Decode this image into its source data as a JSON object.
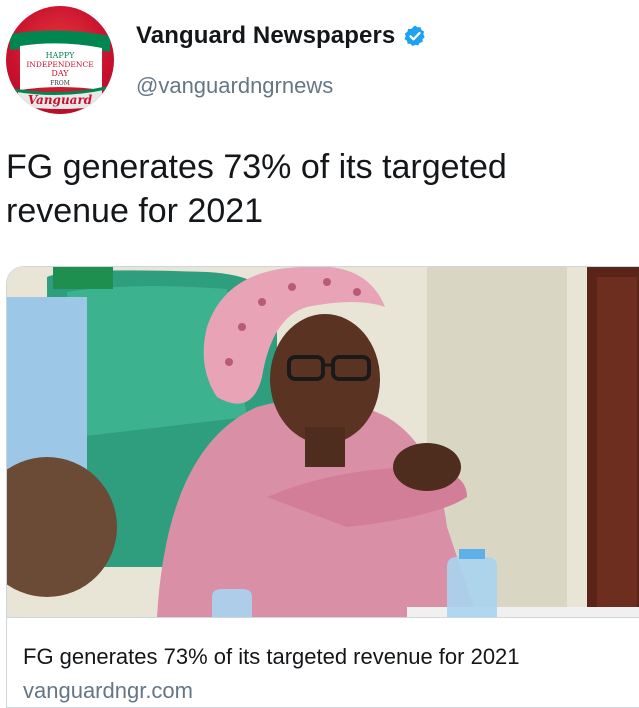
{
  "profile": {
    "display_name": "Vanguard Newspapers",
    "handle": "@vanguardngrnews",
    "avatar_text": [
      "HAPPY",
      "INDEPENDENCE",
      "DAY",
      "FROM",
      "Vanguard"
    ]
  },
  "tweet": {
    "text": "FG generates 73% of its targeted revenue for 2021"
  },
  "card": {
    "title": "FG generates 73% of its targeted revenue for 2021",
    "domain": "vanguardngr.com"
  },
  "colors": {
    "verified_blue": "#1da1f2",
    "text": "#14171a",
    "secondary_text": "#657786",
    "card_border": "#ccd6dd",
    "avatar_red": "#c8102e",
    "avatar_green": "#008751"
  },
  "icons": {
    "verified": "verified-badge-icon"
  }
}
